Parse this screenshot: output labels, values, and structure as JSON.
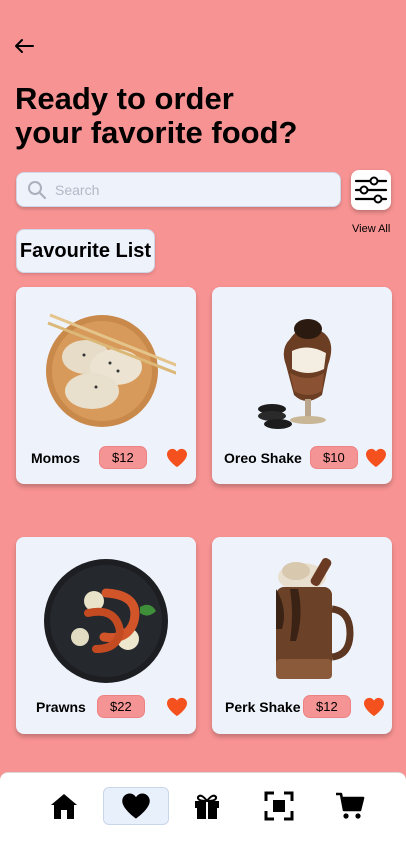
{
  "header": {
    "back_icon": "arrow-left-icon",
    "title_line1": "Ready to order",
    "title_line2": "your favorite food?"
  },
  "search": {
    "placeholder": "Search",
    "value": "",
    "icon": "search-icon"
  },
  "filter": {
    "icon": "sliders-icon"
  },
  "view_all_label": "View All",
  "favourite_list_label": "Favourite List",
  "items": [
    {
      "name": "Momos",
      "price": "$12",
      "image": "momos-image",
      "favorite": true
    },
    {
      "name": "Oreo Shake",
      "price": "$10",
      "image": "oreo-shake-image",
      "favorite": true
    },
    {
      "name": "Prawns",
      "price": "$22",
      "image": "prawns-image",
      "favorite": true
    },
    {
      "name": "Perk Shake",
      "price": "$12",
      "image": "perk-shake-image",
      "favorite": true
    }
  ],
  "bottom_nav": [
    {
      "icon": "home-icon",
      "active": false
    },
    {
      "icon": "heart-icon",
      "active": true
    },
    {
      "icon": "gift-icon",
      "active": false
    },
    {
      "icon": "scan-icon",
      "active": false
    },
    {
      "icon": "cart-icon",
      "active": false
    }
  ],
  "colors": {
    "background": "#f89393",
    "card": "#eef3fb",
    "price_chip": "#f49494",
    "heart": "#f4511e"
  }
}
